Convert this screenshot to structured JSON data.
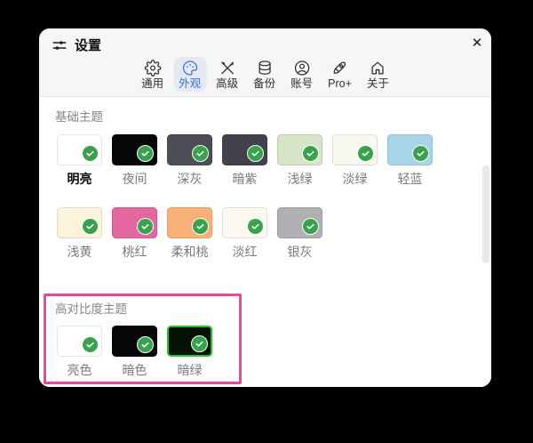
{
  "window": {
    "title": "设置",
    "title_icon": "sliders-icon",
    "close_label": "✕"
  },
  "tabs": [
    {
      "id": "general",
      "label": "通用",
      "icon": "gear-icon",
      "selected": false
    },
    {
      "id": "appearance",
      "label": "外观",
      "icon": "palette-icon",
      "selected": true
    },
    {
      "id": "advanced",
      "label": "高级",
      "icon": "tools-icon",
      "selected": false
    },
    {
      "id": "backup",
      "label": "备份",
      "icon": "database-icon",
      "selected": false
    },
    {
      "id": "account",
      "label": "账号",
      "icon": "account-icon",
      "selected": false
    },
    {
      "id": "pro",
      "label": "Pro+",
      "icon": "rocket-icon",
      "selected": false
    },
    {
      "id": "about",
      "label": "关于",
      "icon": "home-icon",
      "selected": false
    }
  ],
  "basic_section": {
    "title": "基础主题",
    "themes": [
      {
        "name": "明亮",
        "color": "#ffffff",
        "selected": true
      },
      {
        "name": "夜间",
        "color": "#070707",
        "selected": false
      },
      {
        "name": "深灰",
        "color": "#4b4e56",
        "selected": false
      },
      {
        "name": "暗紫",
        "color": "#42424f",
        "selected": false
      },
      {
        "name": "浅绿",
        "color": "#d8e4c7",
        "selected": false
      },
      {
        "name": "淡绿",
        "color": "#f7f9ef",
        "selected": false
      },
      {
        "name": "轻蓝",
        "color": "#a7d4e9",
        "selected": false
      },
      {
        "name": "浅黄",
        "color": "#fbf3da",
        "selected": false
      },
      {
        "name": "桃红",
        "color": "#e2689f",
        "selected": false
      },
      {
        "name": "柔和桃",
        "color": "#f9b077",
        "selected": false
      },
      {
        "name": "淡红",
        "color": "#fdf9f1",
        "selected": false
      },
      {
        "name": "银灰",
        "color": "#aeb0b4",
        "selected": false
      }
    ]
  },
  "high_contrast_section": {
    "title": "高对比度主题",
    "annotation_color": "#f0459c",
    "themes": [
      {
        "name": "亮色",
        "color": "#ffffff",
        "selected": false
      },
      {
        "name": "暗色",
        "color": "#060606",
        "selected": false
      },
      {
        "name": "暗绿",
        "color": "#051105",
        "border_color": "#25c52b",
        "selected": false
      }
    ]
  },
  "colors": {
    "accent_blue": "#3273e8",
    "selected_tab_bg": "#e4e9f2",
    "check_green": "#39a24d",
    "highlight_green": "#25c52b",
    "annotation_pink": "#f0459c"
  }
}
